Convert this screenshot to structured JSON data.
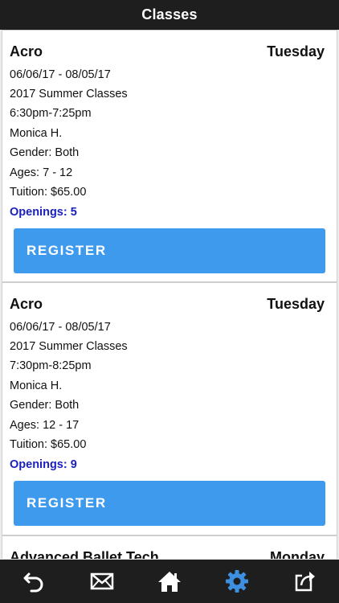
{
  "header": {
    "title": "Classes"
  },
  "classes": [
    {
      "name": "Acro",
      "day": "Tuesday",
      "dates": "06/06/17 - 08/05/17",
      "session": "2017 Summer Classes",
      "time": "6:30pm-7:25pm",
      "instructor": "Monica H.",
      "gender": "Gender: Both",
      "ages": "Ages: 7 - 12",
      "tuition": "Tuition: $65.00",
      "openings": "Openings: 5",
      "register_label": "REGISTER"
    },
    {
      "name": "Acro",
      "day": "Tuesday",
      "dates": "06/06/17 - 08/05/17",
      "session": "2017 Summer Classes",
      "time": "7:30pm-8:25pm",
      "instructor": "Monica H.",
      "gender": "Gender: Both",
      "ages": "Ages: 12 - 17",
      "tuition": "Tuition: $65.00",
      "openings": "Openings: 9",
      "register_label": "REGISTER"
    },
    {
      "name": "Advanced Ballet Tech",
      "day": "Monday"
    }
  ],
  "footer": {
    "items": [
      {
        "icon": "undo-icon",
        "color": "#ffffff"
      },
      {
        "icon": "mail-icon",
        "color": "#ffffff"
      },
      {
        "icon": "home-icon",
        "color": "#ffffff"
      },
      {
        "icon": "gear-icon",
        "color": "#3d8fe0"
      },
      {
        "icon": "share-icon",
        "color": "#ffffff"
      }
    ]
  }
}
